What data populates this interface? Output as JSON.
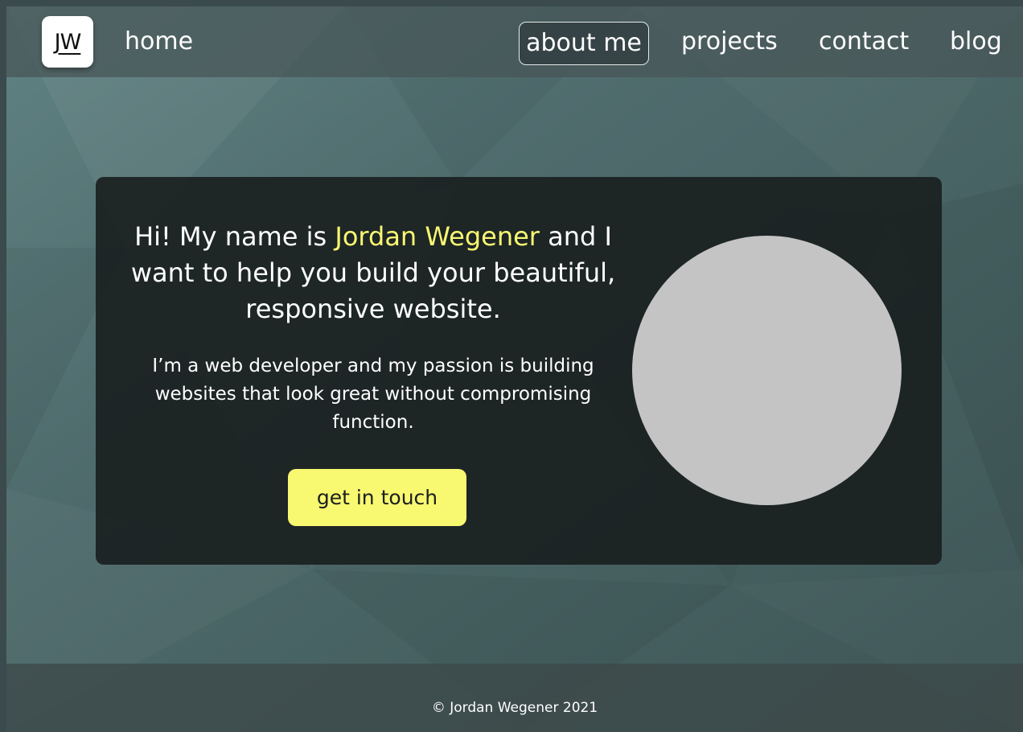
{
  "nav": {
    "logo_text": "JW",
    "home_label": "home",
    "about_label": "about me",
    "projects_label": "projects",
    "contact_label": "contact",
    "blog_label": "blog"
  },
  "hero": {
    "headline_prefix": "Hi! My name is ",
    "headline_name": "Jordan Wegener",
    "headline_suffix": " and I want to help you build your beautiful, responsive website.",
    "subtext": "I’m a web developer and my passion is building websites that look great without compromising function.",
    "cta_label": "get in touch"
  },
  "footer": {
    "copyright": "© Jordan Wegener 2021"
  },
  "colors": {
    "accent": "#f9f871",
    "card": "#1a2020",
    "avatar_placeholder": "#c4c4c4"
  }
}
